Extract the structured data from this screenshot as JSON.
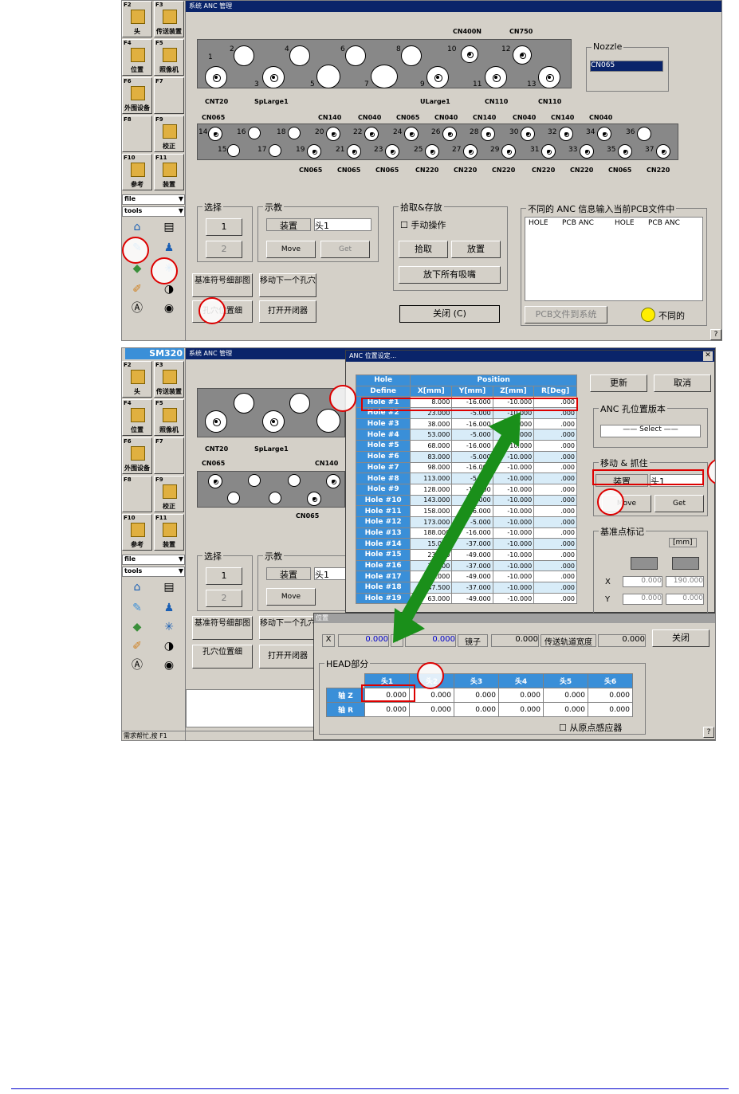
{
  "top_window": {
    "title": "系统 ANC 管理",
    "sidebar": {
      "fkeys": [
        {
          "key": "F2",
          "label": "头"
        },
        {
          "key": "F3",
          "label": "传送装置"
        },
        {
          "key": "F4",
          "label": "位置"
        },
        {
          "key": "F5",
          "label": "照像机"
        },
        {
          "key": "F6",
          "label": "外围设备"
        },
        {
          "key": "F7",
          "label": ""
        },
        {
          "key": "F8",
          "label": ""
        },
        {
          "key": "F9",
          "label": "校正"
        },
        {
          "key": "F10",
          "label": "参考"
        },
        {
          "key": "F11",
          "label": "装置"
        }
      ],
      "combo_file": "file",
      "combo_tools": "tools"
    },
    "top_labels": [
      "CN400N",
      "CN750"
    ],
    "holes_row1": [
      "1",
      "2",
      "3",
      "4",
      "5",
      "6",
      "7",
      "8",
      "9",
      "10",
      "11",
      "12",
      "13"
    ],
    "row1_bottom_labels": [
      "CNT20",
      "SpLarge1",
      "ULarge1",
      "CN110",
      "CN110"
    ],
    "nozzle": {
      "title": "Nozzle",
      "value": "CN065"
    },
    "row2_top_labels": [
      "CN065",
      "CN140",
      "CN040",
      "CN065",
      "CN040",
      "CN140",
      "CN040",
      "CN140",
      "CN040"
    ],
    "holes_row2": [
      "14",
      "15",
      "16",
      "17",
      "18",
      "19",
      "20",
      "21",
      "22",
      "23",
      "24",
      "25",
      "26",
      "27",
      "28",
      "29",
      "30",
      "31",
      "32",
      "33",
      "34",
      "35",
      "36",
      "37"
    ],
    "row2_bottom_labels": [
      "CN065",
      "CN065",
      "CN065",
      "CN220",
      "CN220",
      "CN220",
      "CN220",
      "CN220",
      "CN065",
      "CN220"
    ],
    "select_group": {
      "title": "选择",
      "v1": "1",
      "v2": "2"
    },
    "teach_group": {
      "title": "示教",
      "device": "装置",
      "head": "头1",
      "move": "Move",
      "get": "Get"
    },
    "pick_group": {
      "title": "拾取&存放",
      "manual": "手动操作",
      "pick": "拾取",
      "place": "放置",
      "release_all": "放下所有吸嘴"
    },
    "diff_group": {
      "title": "不同的 ANC 信息输入当前PCB文件中",
      "cols": [
        "HOLE",
        "PCB ANC",
        "HOLE",
        "PCB ANC"
      ],
      "pcb_btn": "PCB文件到系统",
      "legend": "不同的"
    },
    "btn_fiducial": "基准符号细部图",
    "btn_move_next": "移动下一个孔穴",
    "btn_hole_detail": "孔穴位置细",
    "btn_open_close": "打开开闭器",
    "btn_close": "关闭 (C)",
    "help": "?"
  },
  "bottom_window": {
    "logo": "SM320",
    "title": "系统 ANC 管理",
    "dialog_title": "ANC 位置设定...",
    "table": {
      "h_hole": "Hole",
      "h_position": "Position",
      "h_define": "Define",
      "cols": [
        "X[mm]",
        "Y[mm]",
        "Z[mm]",
        "R[Deg]"
      ],
      "rows": [
        [
          "Hole #1",
          "8.000",
          "-16.000",
          "-10.000",
          ".000"
        ],
        [
          "Hole #2",
          "23.000",
          "-5.000",
          "-10.000",
          ".000"
        ],
        [
          "Hole #3",
          "38.000",
          "-16.000",
          "-10.000",
          ".000"
        ],
        [
          "Hole #4",
          "53.000",
          "-5.000",
          "-10.000",
          ".000"
        ],
        [
          "Hole #5",
          "68.000",
          "-16.000",
          "-10.000",
          ".000"
        ],
        [
          "Hole #6",
          "83.000",
          "-5.000",
          "-10.000",
          ".000"
        ],
        [
          "Hole #7",
          "98.000",
          "-16.000",
          "-10.000",
          ".000"
        ],
        [
          "Hole #8",
          "113.000",
          "-5.000",
          "-10.000",
          ".000"
        ],
        [
          "Hole #9",
          "128.000",
          "-16.000",
          "-10.000",
          ".000"
        ],
        [
          "Hole #10",
          "143.000",
          "-5.000",
          "-10.000",
          ".000"
        ],
        [
          "Hole #11",
          "158.000",
          "-16.000",
          "-10.000",
          ".000"
        ],
        [
          "Hole #12",
          "173.000",
          "-5.000",
          "-10.000",
          ".000"
        ],
        [
          "Hole #13",
          "188.000",
          "-16.000",
          "-10.000",
          ".000"
        ],
        [
          "Hole #14",
          "15.000",
          "-37.000",
          "-10.000",
          ".000"
        ],
        [
          "Hole #15",
          "23.000",
          "-49.000",
          "-10.000",
          ".000"
        ],
        [
          "Hole #16",
          "31.000",
          "-37.000",
          "-10.000",
          ".000"
        ],
        [
          "Hole #17",
          "39.000",
          "-49.000",
          "-10.000",
          ".000"
        ],
        [
          "Hole #18",
          "47.500",
          "-37.000",
          "-10.000",
          ".000"
        ],
        [
          "Hole #19",
          "63.000",
          "-49.000",
          "-10.000",
          ".000"
        ]
      ]
    },
    "update": "更新",
    "cancel": "取消",
    "version_group": {
      "title": "ANC 孔位置版本",
      "select": "—— Select ——"
    },
    "move_group": {
      "title": "移动 & 抓住",
      "device": "装置",
      "head": "头1",
      "move": "Move",
      "get": "Get"
    },
    "ref_group": {
      "title": "基准点标记",
      "unit": "[mm]",
      "x_label": "X",
      "y_label": "Y",
      "x1": "0.000",
      "x2": "190.000",
      "y1": "0.000",
      "y2": "0.000"
    },
    "position_dialog": {
      "title": "位置",
      "x_label": "X",
      "x_val": "0.000",
      "y_label": "Y",
      "y_val": "0.000",
      "lens_label": "镜子",
      "lens_val": "0.000",
      "conveyor_label": "传送轨道宽度",
      "conveyor_val": "0.000",
      "close": "关闭",
      "head_title": "HEAD部分",
      "heads": [
        "头1",
        "头2",
        "头3",
        "头4",
        "头5",
        "头6"
      ],
      "axis_z": "轴 Z",
      "axis_r": "轴 R",
      "z_vals": [
        "0.000",
        "0.000",
        "0.000",
        "0.000",
        "0.000",
        "0.000"
      ],
      "r_vals": [
        "0.000",
        "0.000",
        "0.000",
        "0.000",
        "0.000",
        "0.000"
      ],
      "origin": "从原点感应器",
      "help": "?"
    },
    "status": "需求帮忙,按 F1"
  }
}
